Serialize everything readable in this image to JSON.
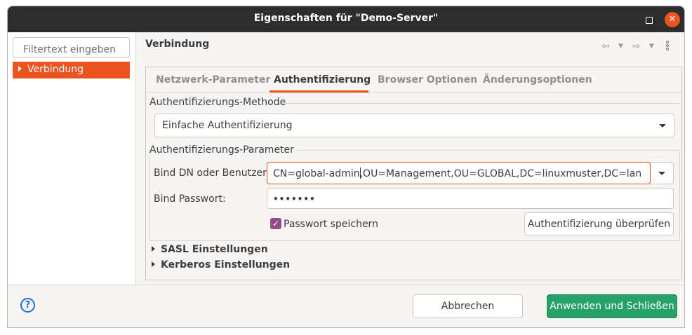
{
  "window": {
    "title": "Eigenschaften für \"Demo-Server\"",
    "close_glyph": "✕"
  },
  "sidebar": {
    "filter_placeholder": "Filtertext eingeben",
    "items": [
      {
        "label": "Verbindung",
        "selected": true
      }
    ]
  },
  "header": {
    "title": "Verbindung",
    "nav_icons": [
      "back-arrow-icon",
      "back-dropdown-icon",
      "forward-arrow-icon",
      "forward-dropdown-icon",
      "view-menu-icon"
    ],
    "back_glyph": "⇦",
    "forward_glyph": "⇨",
    "dropdown_glyph": "▼"
  },
  "tabs": [
    {
      "label": "Netzwerk-Parameter",
      "active": false
    },
    {
      "label": "Authentifizierung",
      "active": true
    },
    {
      "label": "Browser Optionen",
      "active": false
    },
    {
      "label": "Änderungsoptionen",
      "active": false
    }
  ],
  "auth": {
    "method_group": "Authentifizierungs-Methode",
    "method_value": "Einfache Authentifizierung",
    "params_group": "Authentifizierungs-Parameter",
    "bind_dn_label": "Bind DN oder Benutzer:",
    "bind_dn_before_cursor": "CN=global-admin",
    "bind_dn_after_cursor": ",OU=Management,OU=GLOBAL,DC=linuxmuster,DC=lan",
    "bind_pw_label": "Bind Passwort:",
    "bind_pw_value": "•••••••",
    "save_pw_label": "Passwort speichern",
    "save_pw_checked": true,
    "check_button": "Authentifizierung überprüfen"
  },
  "sections": [
    {
      "label": "SASL Einstellungen"
    },
    {
      "label": "Kerberos Einstellungen"
    }
  ],
  "footer": {
    "help_glyph": "?",
    "cancel": "Abbrechen",
    "apply": "Anwenden und Schließen"
  },
  "colors": {
    "accent": "#e95420",
    "checkbox": "#924d8b",
    "apply_button": "#26a269",
    "help": "#1c71d8",
    "titlebar": "#2d2d2d"
  }
}
